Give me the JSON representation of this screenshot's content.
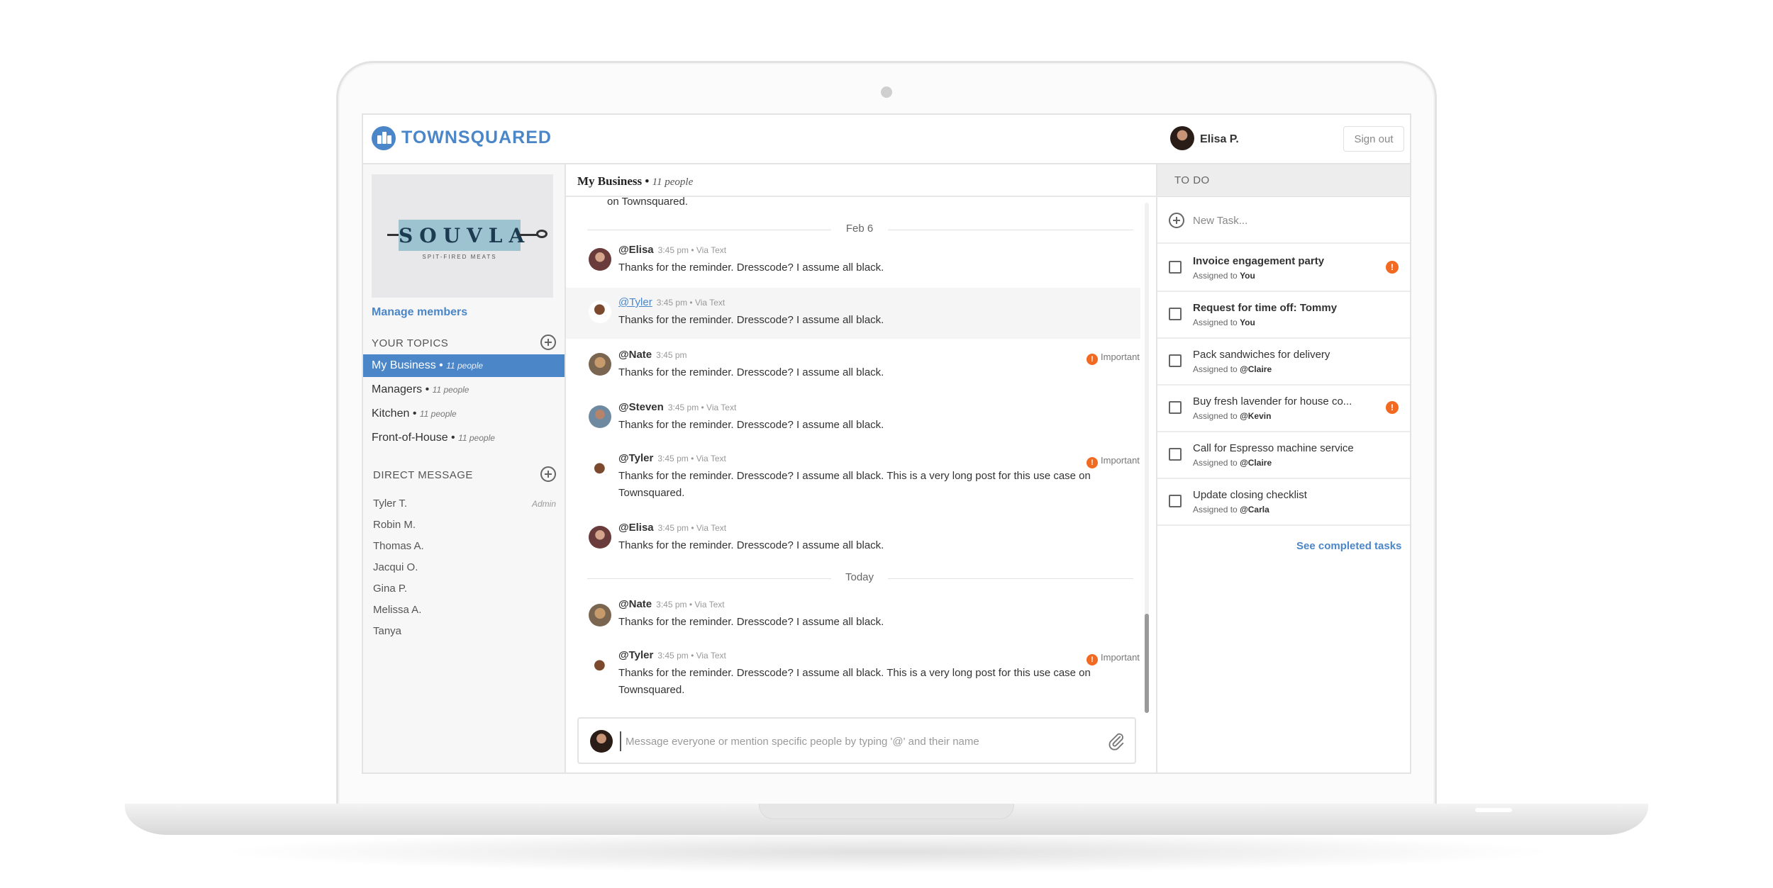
{
  "app": {
    "logo_text": "TOWNSQUARED",
    "user_name": "Elisa P.",
    "sign_out_label": "Sign out"
  },
  "sidebar": {
    "brand_name": "SOUVLA",
    "brand_tagline": "SPIT-FIRED MEATS",
    "manage_members": "Manage members",
    "topics_title": "YOUR TOPICS",
    "topics": [
      {
        "name": "My Business",
        "count": "11 people",
        "active": true
      },
      {
        "name": "Managers",
        "count": "11 people",
        "active": false
      },
      {
        "name": "Kitchen",
        "count": "11 people",
        "active": false
      },
      {
        "name": "Front-of-House",
        "count": "11 people",
        "active": false
      }
    ],
    "dm_title": "DIRECT MESSAGE",
    "dms": [
      {
        "name": "Tyler T.",
        "role": "Admin"
      },
      {
        "name": "Robin M.",
        "role": ""
      },
      {
        "name": "Thomas A.",
        "role": ""
      },
      {
        "name": "Jacqui O.",
        "role": ""
      },
      {
        "name": "Gina P.",
        "role": ""
      },
      {
        "name": "Melissa A.",
        "role": ""
      },
      {
        "name": "Tanya",
        "role": ""
      }
    ]
  },
  "chat": {
    "title": "My Business",
    "subtitle": "11 people",
    "cut_text": "on Townsquared.",
    "date_feb6": "Feb 6",
    "date_today": "Today",
    "important_label": "Important",
    "messages": [
      {
        "author": "@Elisa",
        "meta": "3:45 pm • Via Text",
        "text": "Thanks for the reminder. Dresscode? I assume all black.",
        "important": false
      },
      {
        "author": "@Tyler",
        "meta": "3:45 pm • Via Text",
        "text": "Thanks for the reminder. Dresscode? I assume all black.",
        "important": false
      },
      {
        "author": "@Nate",
        "meta": "3:45 pm",
        "text": "Thanks for the reminder. Dresscode? I assume all black.",
        "important": true
      },
      {
        "author": "@Steven",
        "meta": "3:45 pm • Via Text",
        "text": "Thanks for the reminder. Dresscode? I assume all black.",
        "important": false
      },
      {
        "author": "@Tyler",
        "meta": "3:45 pm • Via Text",
        "text": "Thanks for the reminder. Dresscode? I assume all black. This is a very long post for this use case on Townsquared.",
        "important": true
      },
      {
        "author": "@Elisa",
        "meta": "3:45 pm • Via Text",
        "text": "Thanks for the reminder. Dresscode? I assume all black.",
        "important": false
      },
      {
        "author": "@Nate",
        "meta": "3:45 pm • Via Text",
        "text": "Thanks for the reminder. Dresscode? I assume all black.",
        "important": false
      },
      {
        "author": "@Tyler",
        "meta": "3:45 pm • Via Text",
        "text": "Thanks for the reminder. Dresscode? I assume all black. This is a very long post for this use case on Townsquared.",
        "important": true
      }
    ],
    "composer_placeholder": "Message everyone or mention specific people by typing '@' and their name"
  },
  "todo": {
    "title": "TO DO",
    "new_task_placeholder": "New Task...",
    "assigned_prefix": "Assigned to",
    "tasks": [
      {
        "title": "Invoice engagement party",
        "assignee": "You",
        "bold": true,
        "important": true
      },
      {
        "title": "Request for time off: Tommy",
        "assignee": "You",
        "bold": true,
        "important": false
      },
      {
        "title": "Pack sandwiches for delivery",
        "assignee": "@Claire",
        "bold": false,
        "important": false
      },
      {
        "title": "Buy fresh lavender for house co...",
        "assignee": "@Kevin",
        "bold": false,
        "important": true
      },
      {
        "title": "Call for Espresso machine service",
        "assignee": "@Claire",
        "bold": false,
        "important": false
      },
      {
        "title": "Update closing checklist",
        "assignee": "@Carla",
        "bold": false,
        "important": false
      }
    ],
    "see_completed": "See completed tasks"
  },
  "colors": {
    "brand_blue": "#4a86c8",
    "important_orange": "#f26a21"
  }
}
